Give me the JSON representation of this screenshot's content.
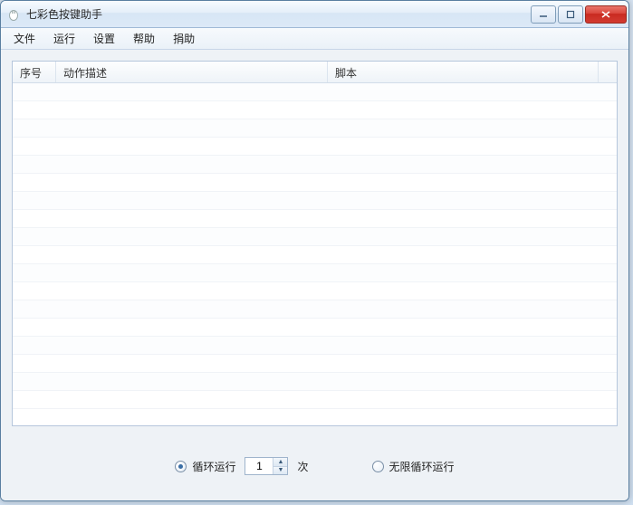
{
  "window": {
    "title": "七彩色按键助手"
  },
  "menu": {
    "file": "文件",
    "run": "运行",
    "settings": "设置",
    "help": "帮助",
    "donate": "捐助"
  },
  "table": {
    "columns": {
      "index": "序号",
      "desc": "动作描述",
      "script": "脚本"
    },
    "rows": []
  },
  "footer": {
    "loop_run_label": "循环运行",
    "loop_count": "1",
    "times_suffix": "次",
    "infinite_loop_label": "无限循环运行",
    "loop_mode": "count"
  }
}
